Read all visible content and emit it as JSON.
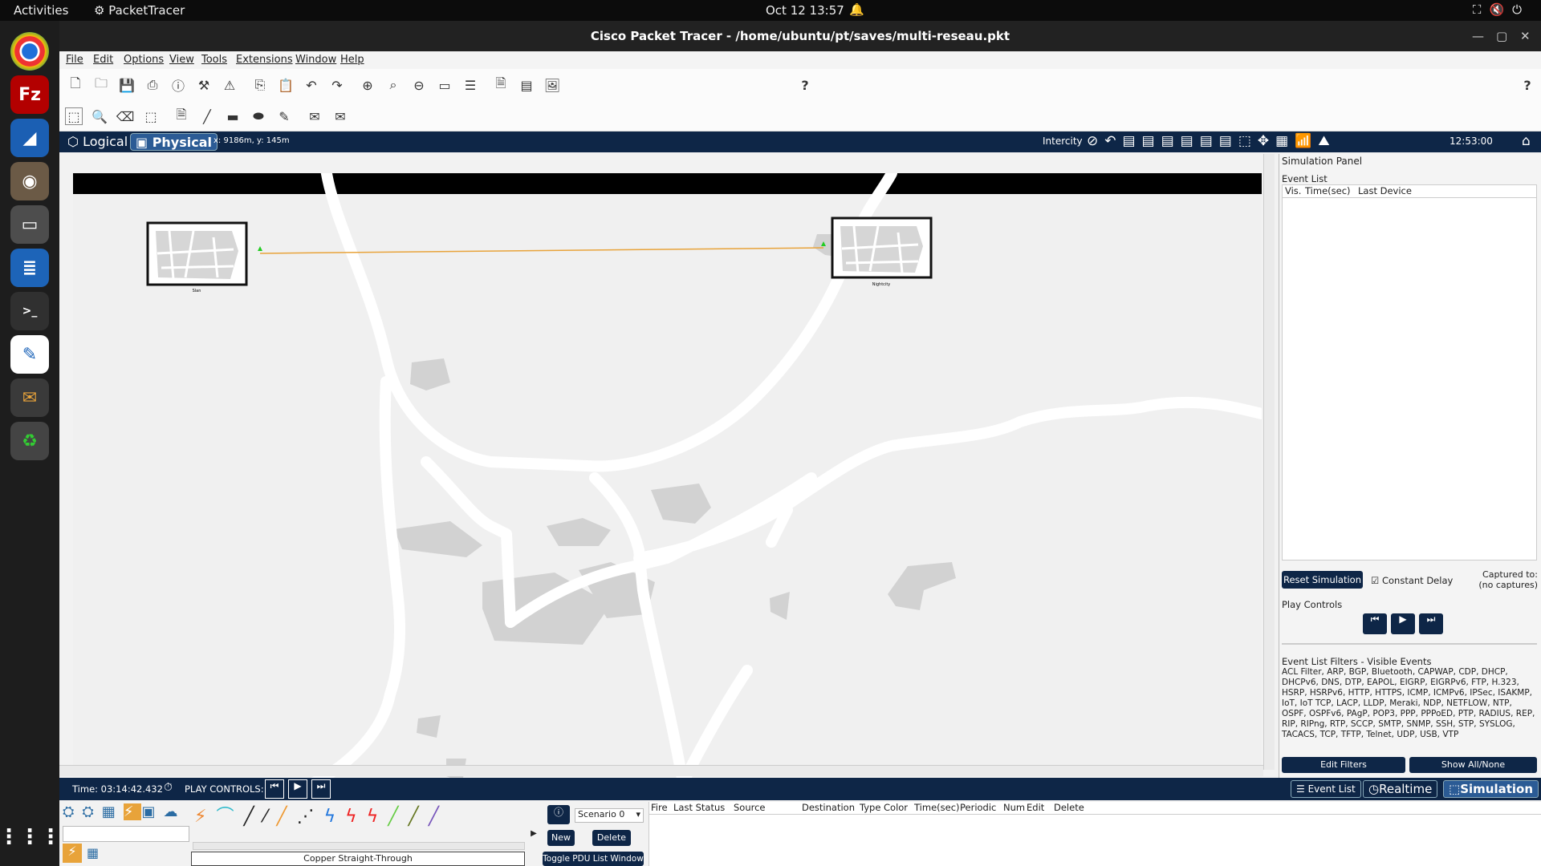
{
  "topbar": {
    "activities": "Activities",
    "app": "PacketTracer",
    "datetime": "Oct 12  13:57"
  },
  "dock_icons": [
    "chrome-icon",
    "filezilla-icon",
    "wireshark-icon",
    "gimp-icon",
    "files-icon",
    "writer-icon",
    "terminal-icon",
    "text-editor-icon",
    "packet-tracer-icon",
    "trash-icon",
    "apps-grid-icon"
  ],
  "window": {
    "title": "Cisco Packet Tracer - /home/ubuntu/pt/saves/multi-reseau.pkt"
  },
  "menu": [
    "File",
    "Edit",
    "Options",
    "View",
    "Tools",
    "Extensions",
    "Window",
    "Help"
  ],
  "toolbar": {
    "help": "?"
  },
  "nav": {
    "logical": "Logical",
    "physical": "Physical",
    "coords": "x: 9186m, y: 145m",
    "location": "Intercity",
    "clock": "12:53:00"
  },
  "map": {
    "left_label": "Slan",
    "right_label": "Nightcity"
  },
  "sim": {
    "title": "Simulation Panel",
    "event_list": "Event List",
    "cols": [
      "Vis.",
      "Time(sec)",
      "Last Device"
    ],
    "reset": "Reset Simulation",
    "constant_delay": "Constant Delay",
    "captured": "Captured to:",
    "captures": "(no captures)",
    "play_controls": "Play Controls",
    "filters_title": "Event List Filters - Visible Events",
    "filters": "ACL Filter, ARP, BGP, Bluetooth, CAPWAP, CDP, DHCP, DHCPv6, DNS, DTP, EAPOL, EIGRP, EIGRPv6, FTP, H.323, HSRP, HSRPv6, HTTP, HTTPS, ICMP, ICMPv6, IPSec, ISAKMP, IoT, IoT TCP, LACP, LLDP, Meraki, NDP, NETFLOW, NTP, OSPF, OSPFv6, PAgP, POP3, PPP, PPPoED, PTP, RADIUS, REP, RIP, RIPng, RTP, SCCP, SMTP, SNMP, SSH, STP, SYSLOG, TACACS, TCP, TFTP, Telnet, UDP, USB, VTP",
    "edit_filters": "Edit Filters",
    "show_all": "Show All/None"
  },
  "timebar": {
    "time": "Time: 03:14:42.432",
    "play": "PLAY CONTROLS:"
  },
  "modes": {
    "event_list": "Event List",
    "realtime": "Realtime",
    "simulation": "Simulation"
  },
  "bottom": {
    "cable_label": "Copper Straight-Through",
    "scenario": "Scenario 0",
    "new": "New",
    "delete": "Delete",
    "toggle": "Toggle PDU List Window",
    "pdu_cols": [
      "Fire",
      "Last Status",
      "Source",
      "Destination",
      "Type",
      "Color",
      "Time(sec)",
      "Periodic",
      "Num",
      "Edit",
      "Delete"
    ]
  },
  "colors": {
    "navy": "#0e2647",
    "link": "#e8a33a"
  }
}
